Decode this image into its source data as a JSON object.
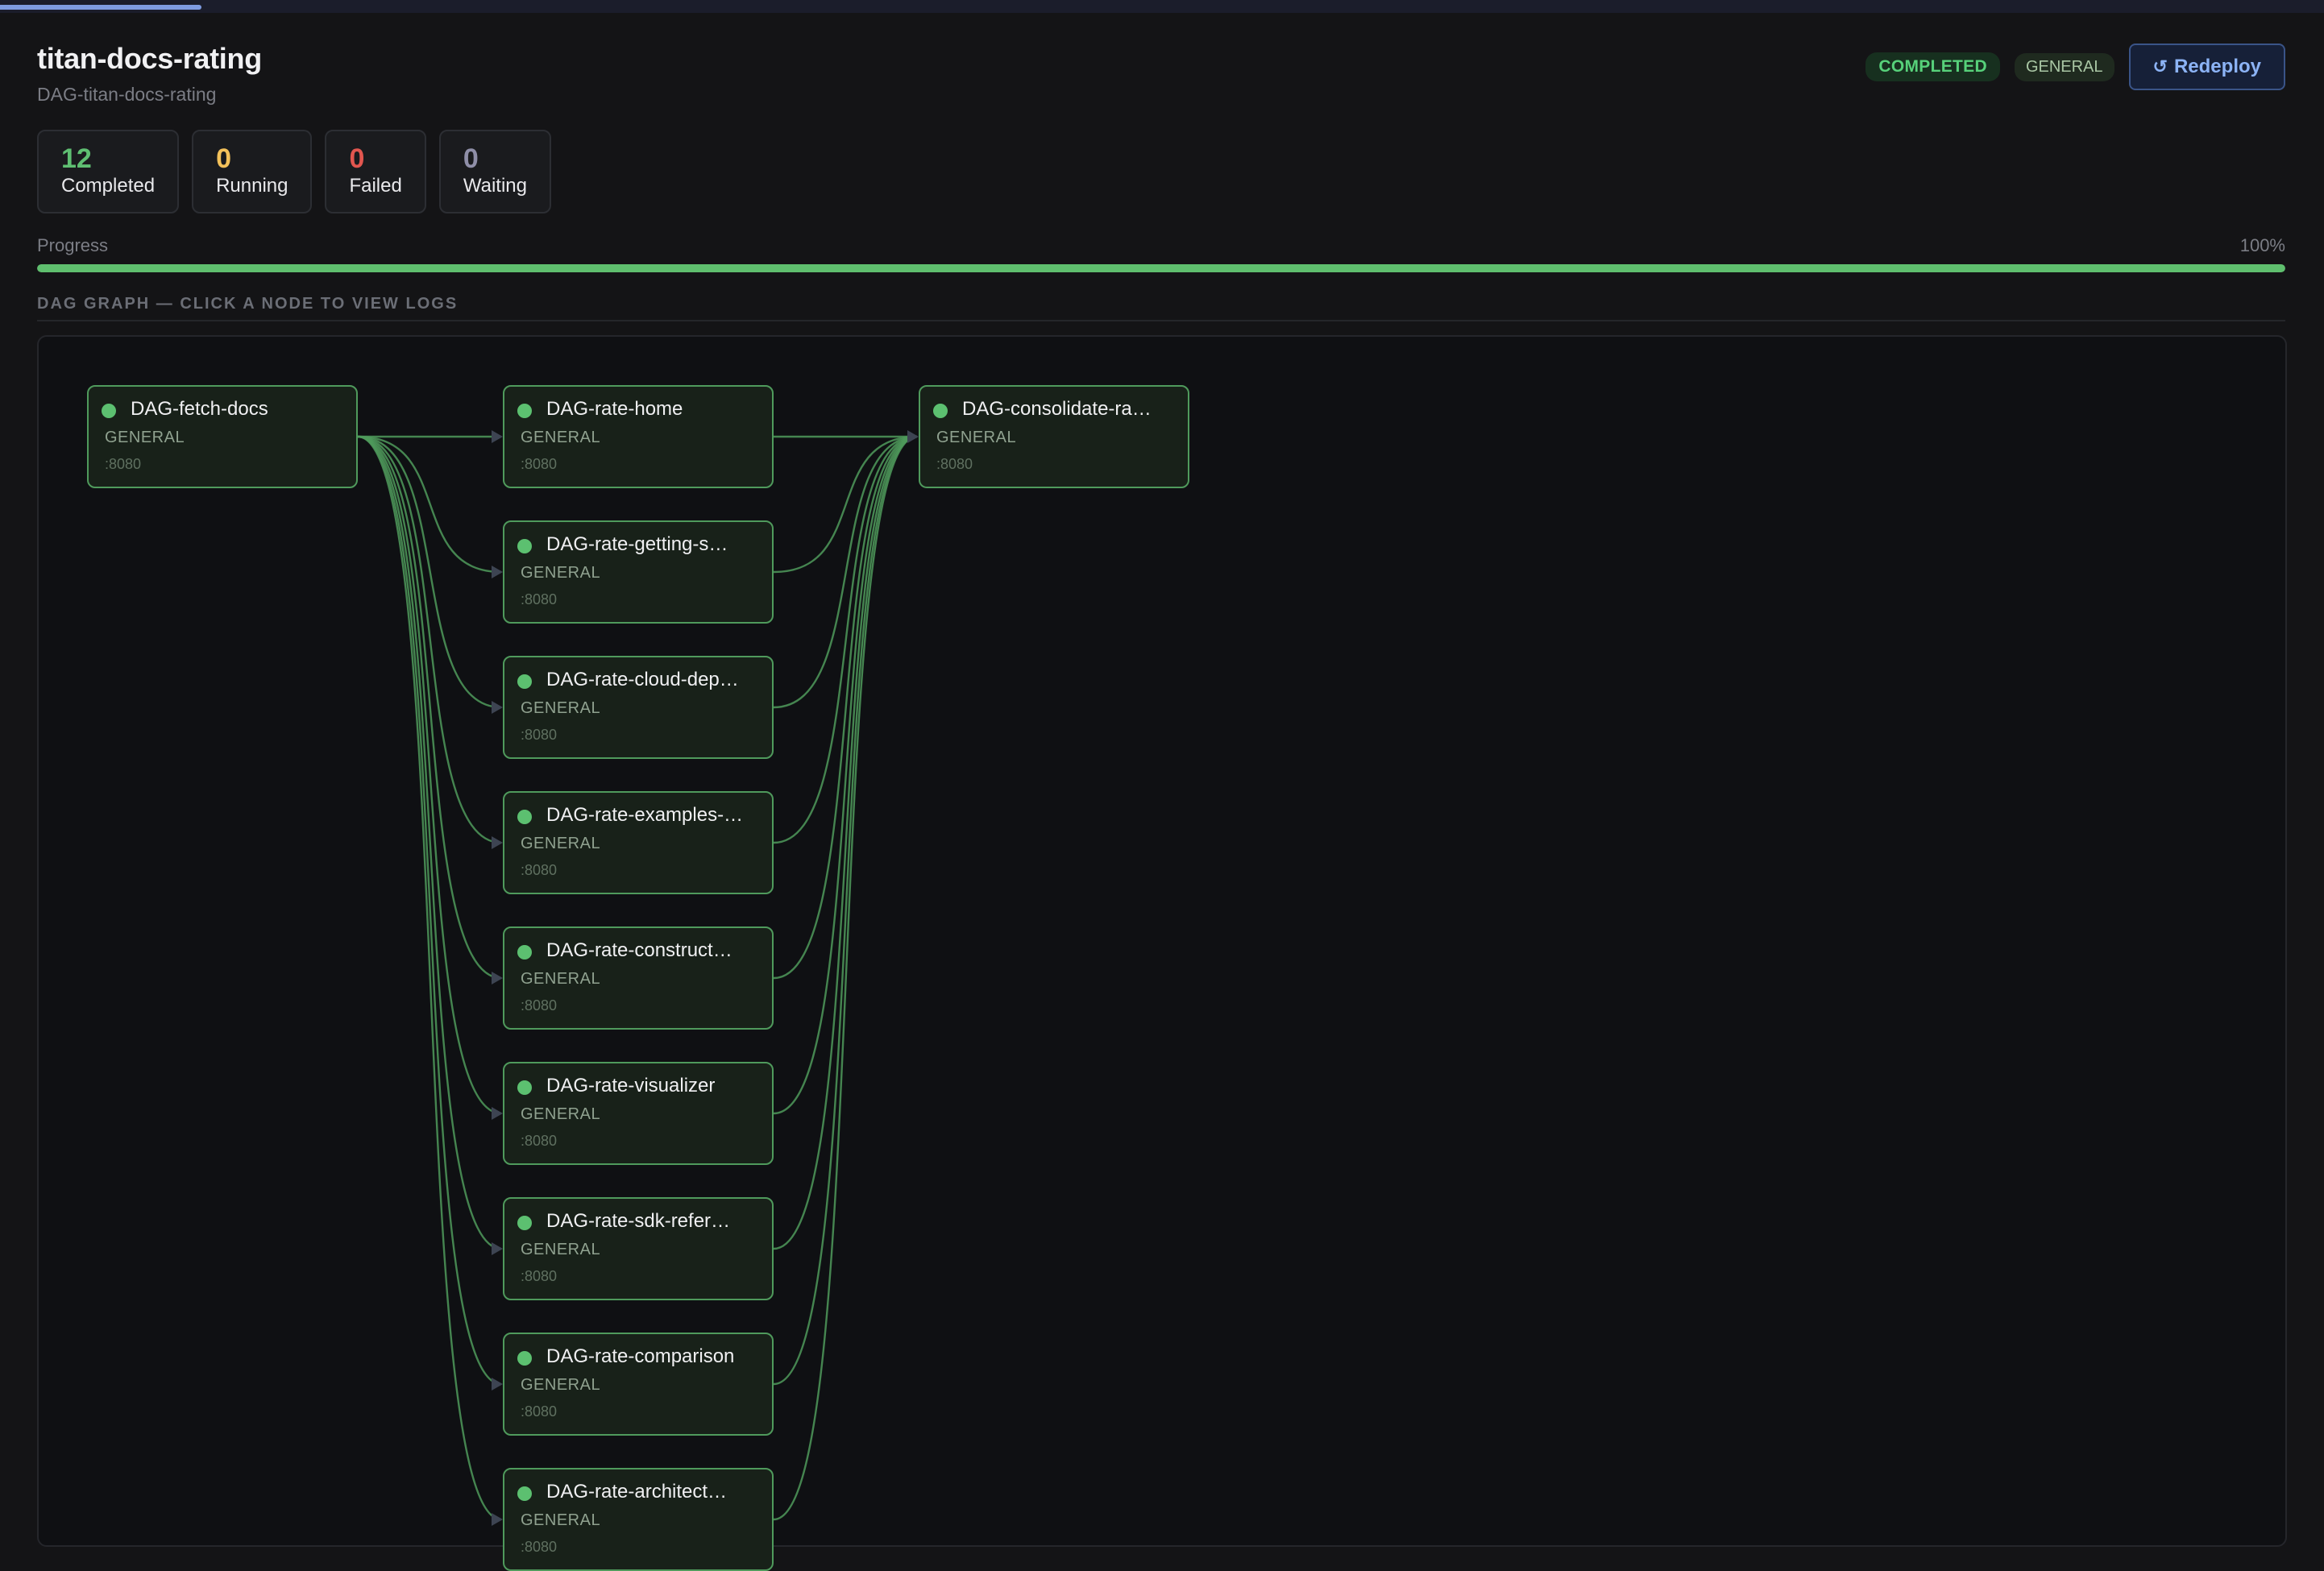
{
  "header": {
    "title": "titan-docs-rating",
    "subtitle": "DAG-titan-docs-rating",
    "status_badge": "COMPLETED",
    "type_badge": "GENERAL",
    "redeploy_icon": "↺",
    "redeploy_label": "Redeploy"
  },
  "stats": {
    "completed": {
      "value": "12",
      "label": "Completed"
    },
    "running": {
      "value": "0",
      "label": "Running"
    },
    "failed": {
      "value": "0",
      "label": "Failed"
    },
    "waiting": {
      "value": "0",
      "label": "Waiting"
    }
  },
  "progress": {
    "label": "Progress",
    "percent_text": "100%",
    "value": 1.0
  },
  "graph_section": {
    "title": "DAG GRAPH — CLICK A NODE TO VIEW LOGS"
  },
  "colors": {
    "accent": "#5fbf6e",
    "completed": "#57d17a",
    "redeploy": "#8cb3f5",
    "failed": "#e2564f",
    "running": "#f3c15a"
  },
  "nodes": [
    {
      "name": "DAG-fetch-docs",
      "kind": "GENERAL",
      "port": ":8080"
    },
    {
      "name": "DAG-rate-home",
      "kind": "GENERAL",
      "port": ":8080"
    },
    {
      "name": "DAG-rate-getting-s…",
      "kind": "GENERAL",
      "port": ":8080"
    },
    {
      "name": "DAG-rate-cloud-dep…",
      "kind": "GENERAL",
      "port": ":8080"
    },
    {
      "name": "DAG-rate-examples-…",
      "kind": "GENERAL",
      "port": ":8080"
    },
    {
      "name": "DAG-rate-construct…",
      "kind": "GENERAL",
      "port": ":8080"
    },
    {
      "name": "DAG-rate-visualizer",
      "kind": "GENERAL",
      "port": ":8080"
    },
    {
      "name": "DAG-rate-sdk-refer…",
      "kind": "GENERAL",
      "port": ":8080"
    },
    {
      "name": "DAG-rate-comparison",
      "kind": "GENERAL",
      "port": ":8080"
    },
    {
      "name": "DAG-rate-architect…",
      "kind": "GENERAL",
      "port": ":8080"
    },
    {
      "name": "DAG-consolidate-ra…",
      "kind": "GENERAL",
      "port": ":8080"
    }
  ]
}
